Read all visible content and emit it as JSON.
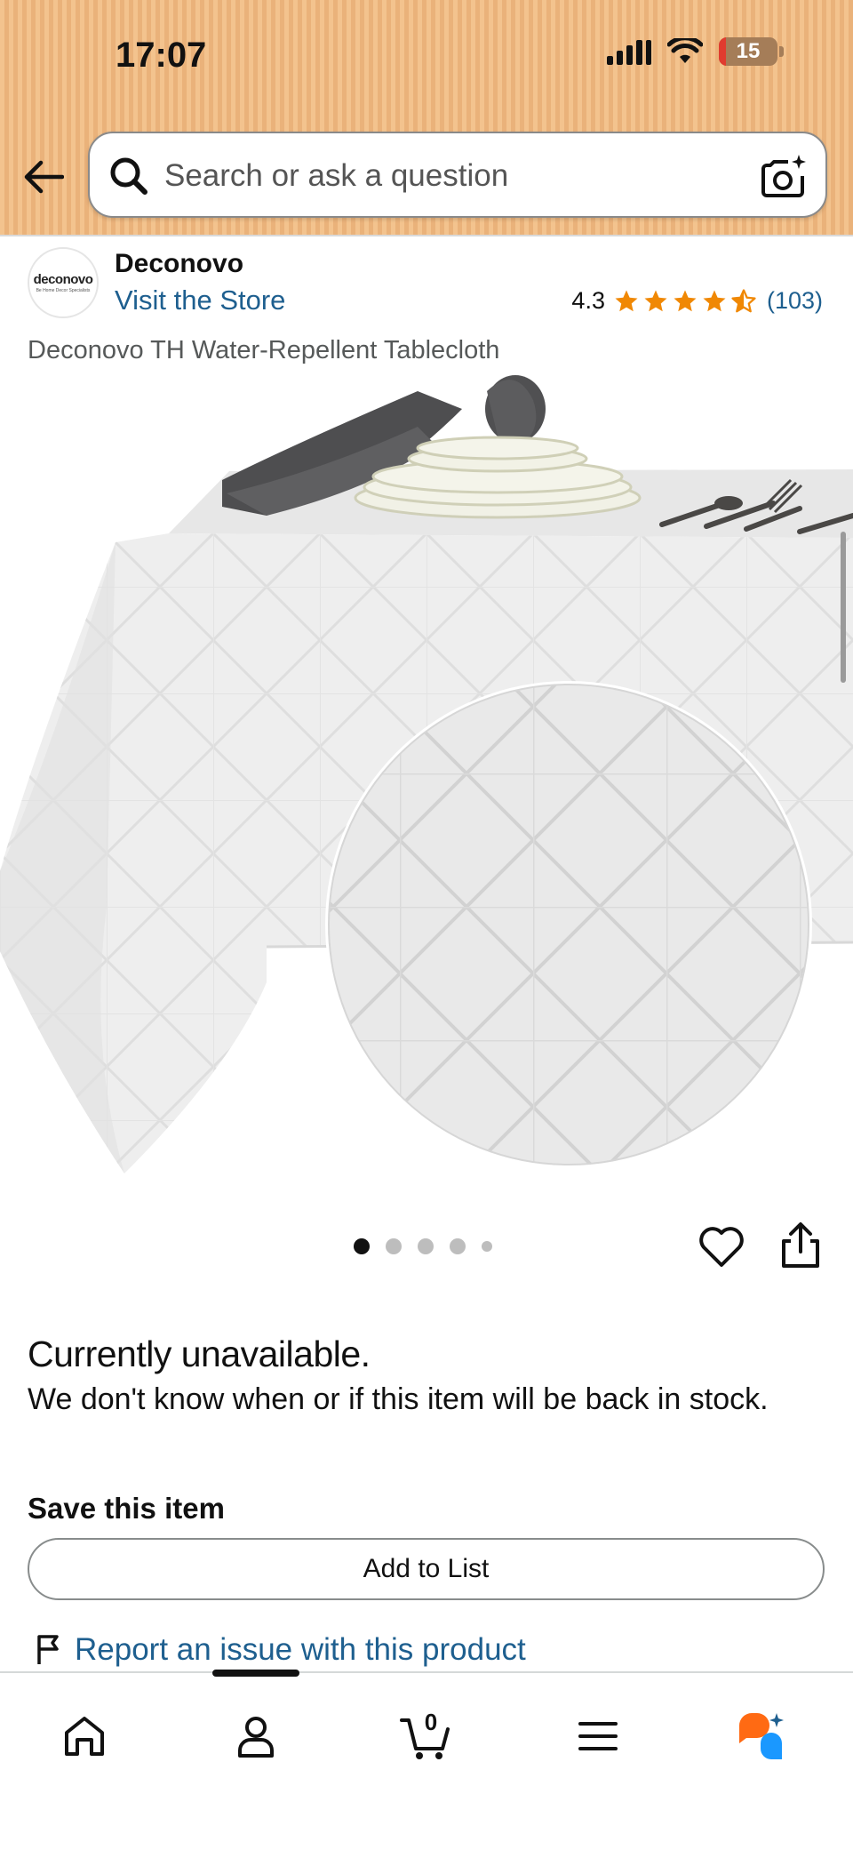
{
  "status_bar": {
    "time": "17:07",
    "battery": "15"
  },
  "search": {
    "placeholder": "Search or ask a question"
  },
  "store": {
    "logo_text": "deconovo",
    "logo_subtext": "Be Home Decor Specialists",
    "brand_name": "Deconovo",
    "visit_label": "Visit the Store",
    "rating": "4.3",
    "rating_count": "(103)",
    "stars_value": 4.3,
    "star_color": "#f08804"
  },
  "product": {
    "title": "Deconovo TH Water-Repellent Tablecloth"
  },
  "carousel": {
    "total_images": 5,
    "active_index": 0
  },
  "availability": {
    "title": "Currently unavailable.",
    "message": "We don't know when or if this item will be back in stock."
  },
  "save": {
    "title": "Save this item",
    "add_to_list_label": "Add to List"
  },
  "report": {
    "label": "Report an issue with this product"
  },
  "bottom_nav": {
    "items": [
      "home-icon",
      "account-icon",
      "cart-icon",
      "menu-icon",
      "rufus-icon"
    ],
    "cart_count": "0"
  },
  "colors": {
    "header_bg": "#efba83",
    "link": "#1e5f8f",
    "rufus_orange": "#ff6a13",
    "rufus_blue": "#1a98ff"
  }
}
